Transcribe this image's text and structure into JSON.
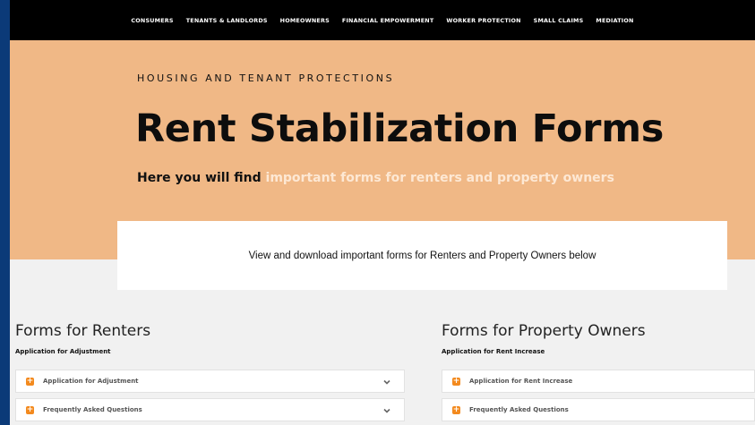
{
  "nav": {
    "items": [
      "CONSUMERS",
      "TENANTS & LANDLORDS",
      "HOMEOWNERS",
      "FINANCIAL EMPOWERMENT",
      "WORKER PROTECTION",
      "SMALL CLAIMS",
      "MEDIATION"
    ]
  },
  "hero": {
    "eyebrow": "HOUSING AND TENANT PROTECTIONS",
    "title": "Rent Stabilization Forms",
    "subtitle_prefix": "Here you will find ",
    "subtitle_highlight": "important forms for renters and property owners",
    "highlight_color": "#fde8d4",
    "background_color": "#f0b886"
  },
  "banner": {
    "text": "View and download important forms for Renters and Property Owners below"
  },
  "renters": {
    "heading": "Forms for Renters",
    "subheading": "Application for Adjustment",
    "items": [
      {
        "label": "Application for Adjustment",
        "icon": "plus-icon"
      },
      {
        "label": "Frequently Asked Questions",
        "icon": "plus-icon"
      }
    ]
  },
  "owners": {
    "heading": "Forms for Property Owners",
    "subheading": "Application for Rent Increase",
    "items": [
      {
        "label": "Application for Rent Increase",
        "icon": "plus-icon"
      },
      {
        "label": "Frequently Asked Questions",
        "icon": "plus-icon"
      }
    ]
  },
  "accent_color": "#f38a1e"
}
